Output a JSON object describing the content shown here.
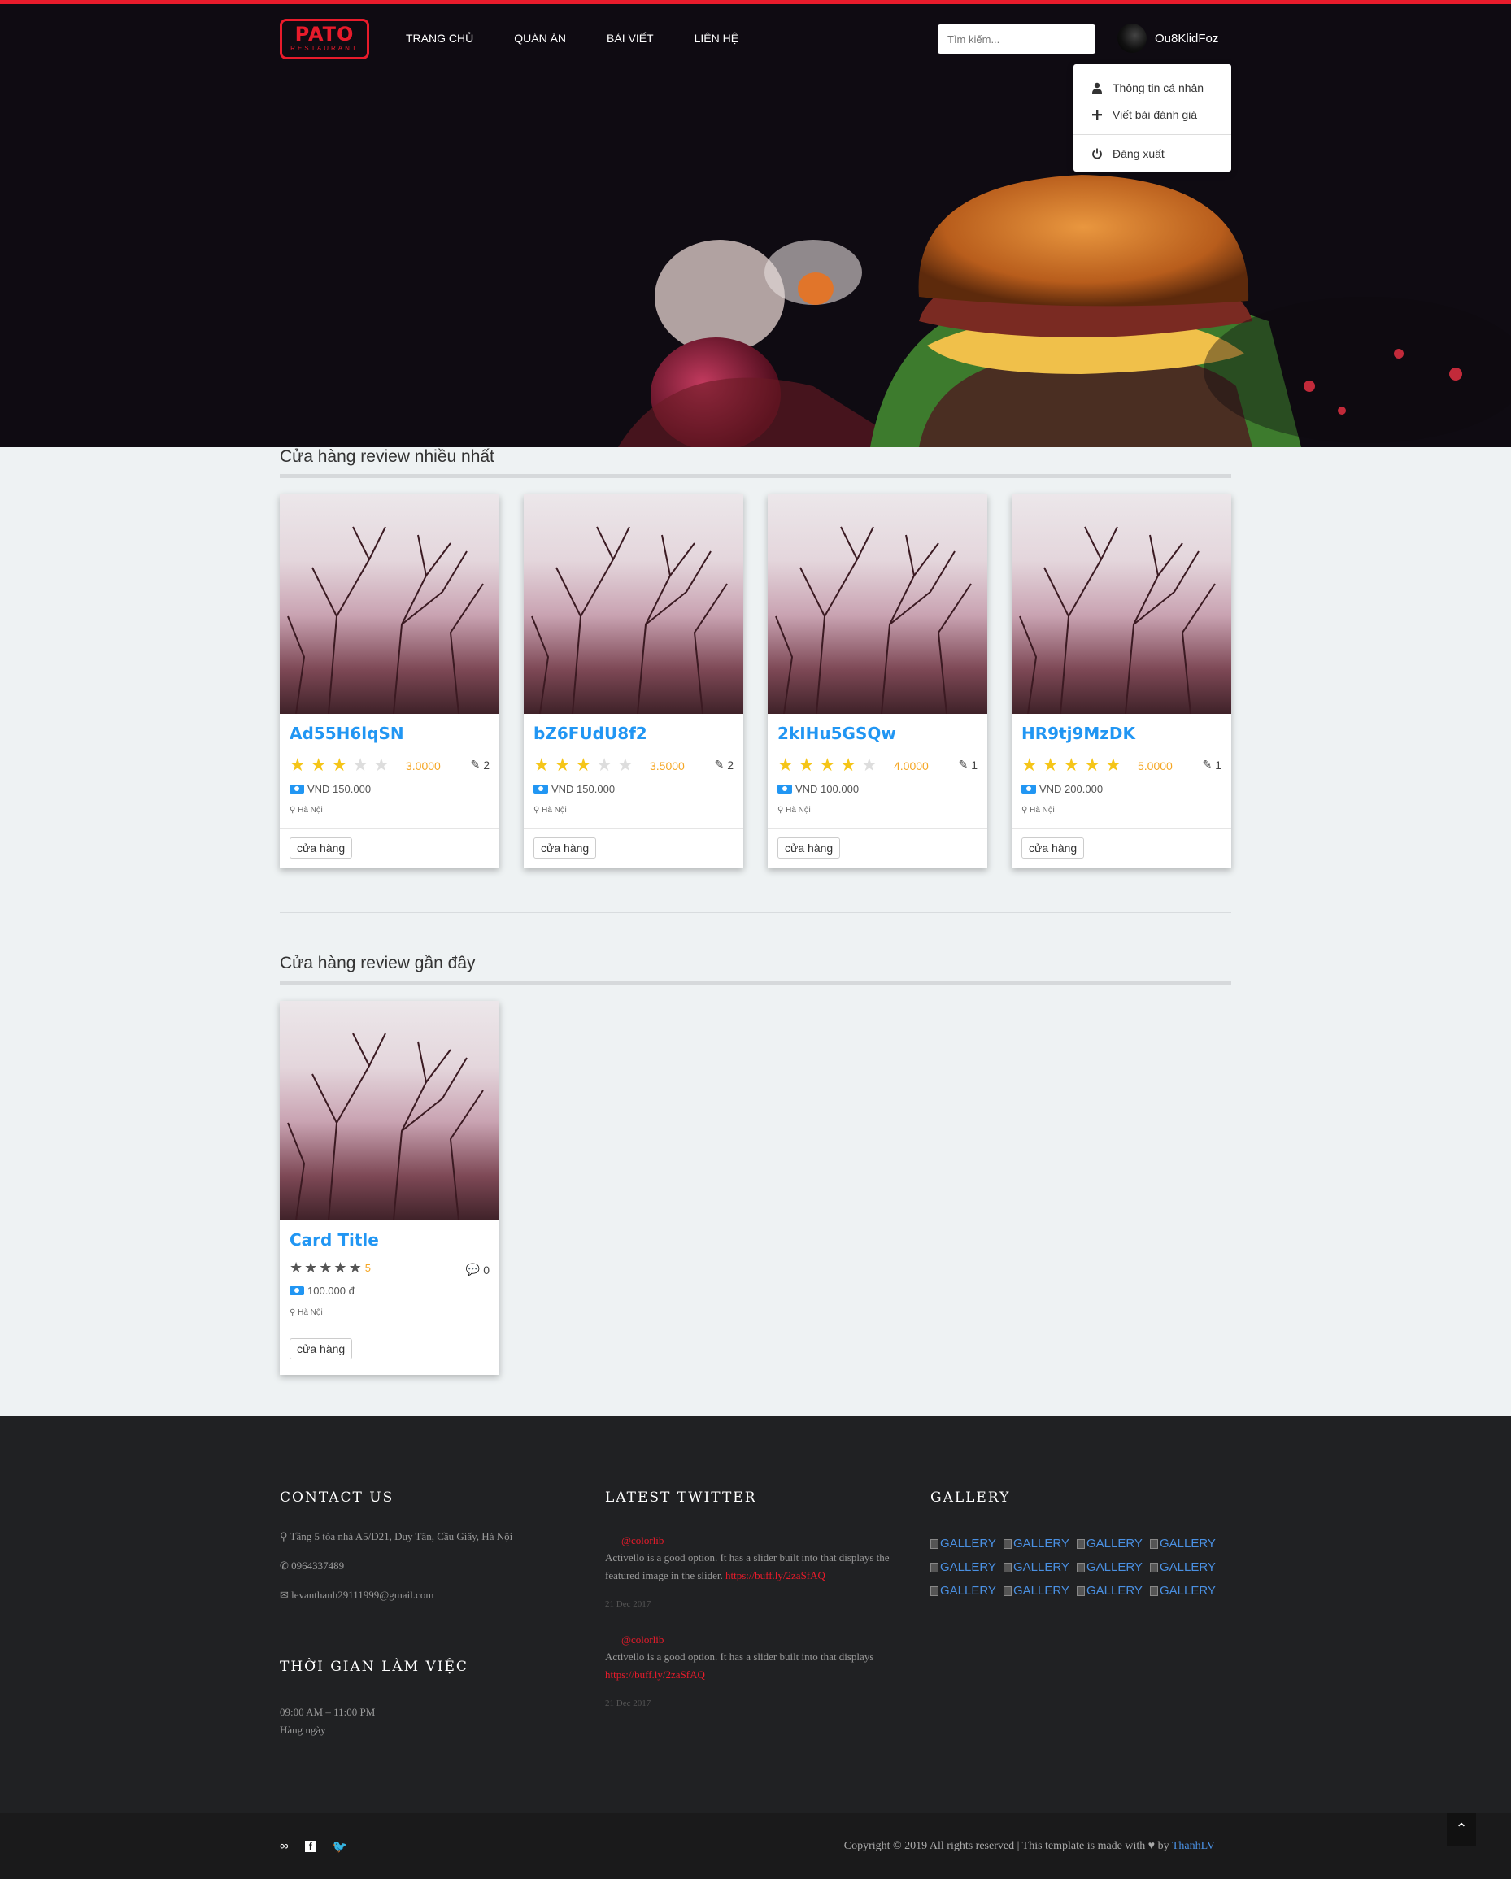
{
  "brand": {
    "name": "PATO",
    "sub": "RESTAURANT"
  },
  "nav": [
    "TRANG CHỦ",
    "QUÁN ĂN",
    "BÀI VIẾT",
    "LIÊN HỆ"
  ],
  "search": {
    "placeholder": "Tìm kiếm..."
  },
  "user": {
    "name": "Ou8KlidFoz"
  },
  "dropdown": [
    "Thông tin cá nhân",
    "Viết bài đánh giá",
    "Đăng xuất"
  ],
  "section1": {
    "title": "Cửa hàng review nhiều nhất"
  },
  "section2": {
    "title": "Cửa hàng review gần đây"
  },
  "top_cards": [
    {
      "title": "Ad55H6lqSN",
      "stars": 3,
      "rating": "3.0000",
      "reviews": "2",
      "price": "VNĐ 150.000",
      "location": "Hà Nội",
      "tag": "cửa hàng"
    },
    {
      "title": "bZ6FUdU8f2",
      "stars": 3,
      "rating": "3.5000",
      "reviews": "2",
      "price": "VNĐ 150.000",
      "location": "Hà Nội",
      "tag": "cửa hàng"
    },
    {
      "title": "2kIHu5GSQw",
      "stars": 4,
      "rating": "4.0000",
      "reviews": "1",
      "price": "VNĐ 100.000",
      "location": "Hà Nội",
      "tag": "cửa hàng"
    },
    {
      "title": "HR9tj9MzDK",
      "stars": 5,
      "rating": "5.0000",
      "reviews": "1",
      "price": "VNĐ 200.000",
      "location": "Hà Nội",
      "tag": "cửa hàng"
    }
  ],
  "recent_card": {
    "title": "Card Title",
    "rating": "5",
    "comments": "0",
    "price": "100.000 đ",
    "location": "Hà Nội",
    "tag": "cửa hàng"
  },
  "footer": {
    "contact_title": "CONTACT US",
    "address": "Tầng 5 tòa nhà A5/D21, Duy Tân, Cầu Giấy, Hà Nội",
    "phone": "0964337489",
    "email": "levanthanh29111999@gmail.com",
    "hours_title": "THỜI GIAN LÀM VIỆC",
    "hours": "09:00 AM – 11:00 PM",
    "days": "Hàng ngày",
    "twitter_title": "LATEST TWITTER",
    "tweets": [
      {
        "handle": "@colorlib",
        "text": "Activello is a good option. It has a slider built into that displays the featured image in the slider.",
        "link": "https://buff.ly/2zaSfAQ",
        "date": "21 Dec 2017"
      },
      {
        "handle": "@colorlib",
        "text": "Activello is a good option. It has a slider built into that displays",
        "link": "https://buff.ly/2zaSfAQ",
        "date": "21 Dec 2017"
      }
    ],
    "gallery_title": "GALLERY",
    "gallery_alt": "GALLERY",
    "copyright": "Copyright © 2019 All rights reserved | This template is made with",
    "by": "by",
    "author": "ThanhLV"
  },
  "colors": {
    "accent": "#e81b2b",
    "link": "#2196f3",
    "star": "#f5c518"
  }
}
